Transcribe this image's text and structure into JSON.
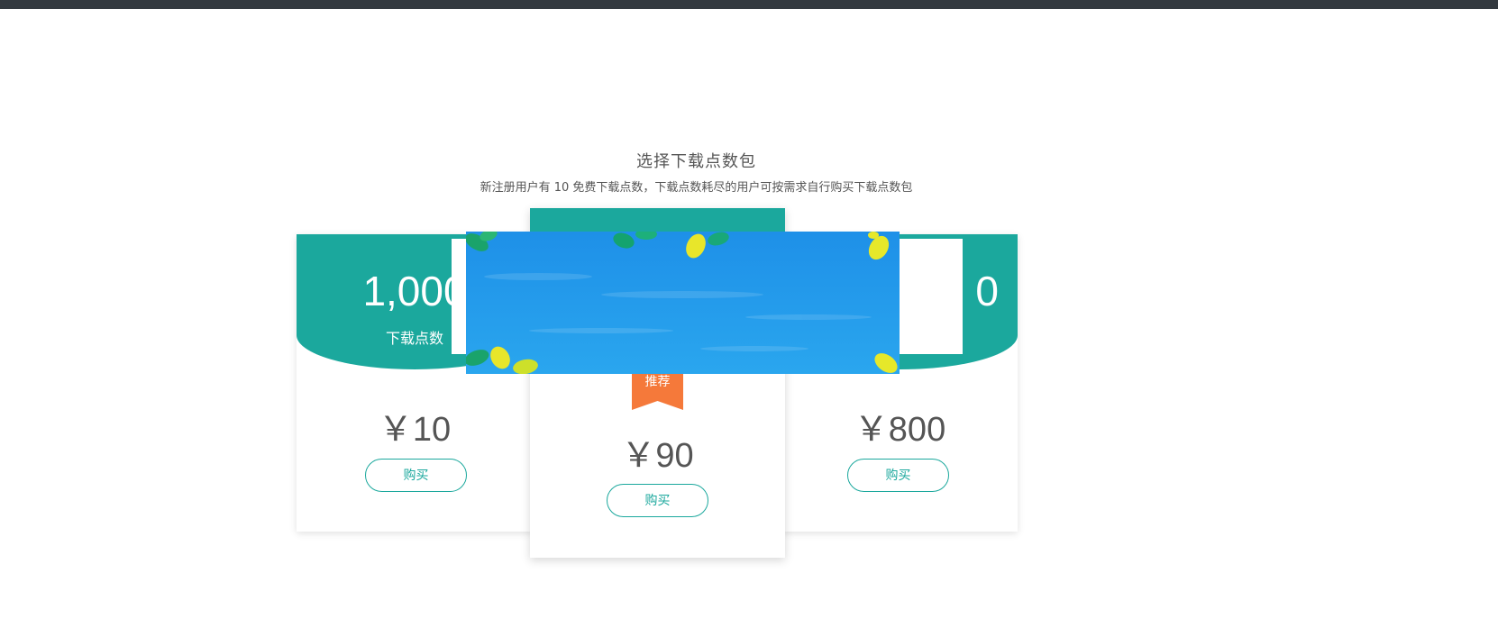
{
  "header": {
    "title": "选择下载点数包",
    "subtitle": "新注册用户有 10 免费下载点数，下载点数耗尽的用户可按需求自行购买下载点数包"
  },
  "packages": [
    {
      "points": "1,000",
      "unit": "下载点数",
      "price": "￥10",
      "buy_label": "购买"
    },
    {
      "ribbon": "推荐",
      "price": "￥90",
      "buy_label": "购买"
    },
    {
      "points": "0",
      "price": "￥800",
      "buy_label": "购买"
    }
  ],
  "colors": {
    "accent": "#1ba89d",
    "ribbon": "#f5793a",
    "banner_sky": "#2196e8"
  },
  "overlay": {
    "icon": "leaves-banner-image"
  }
}
